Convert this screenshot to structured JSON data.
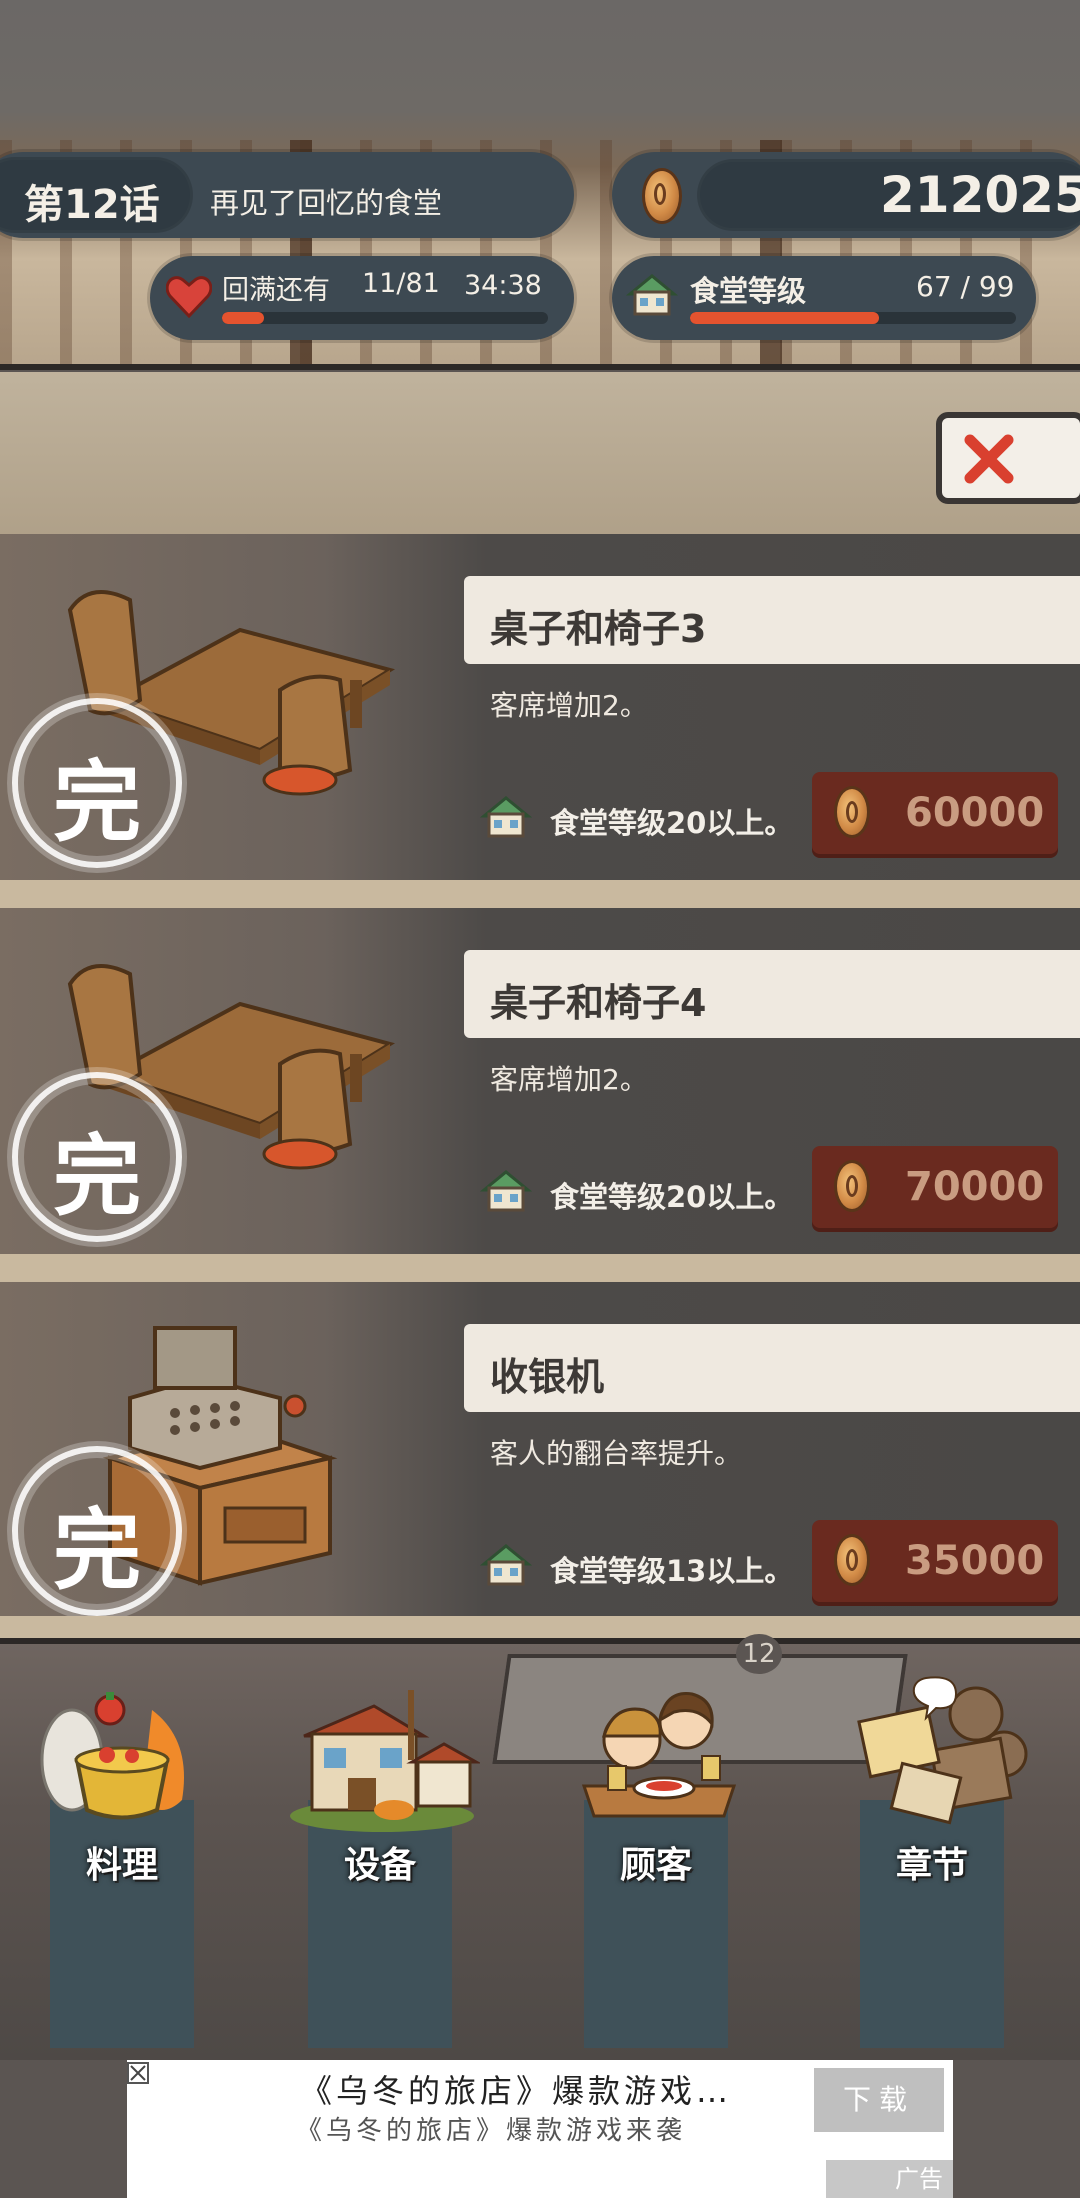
{
  "hud": {
    "chapter_label": "第12话",
    "chapter_title": "再见了回忆的食堂",
    "coins": "212025",
    "stamina_label": "回满还有",
    "stamina_count": "11/81",
    "stamina_timer": "34:38",
    "stamina_progress": 0.13,
    "level_label": "食堂等级",
    "level_value": "67 / 99",
    "level_progress": 0.58
  },
  "items": [
    {
      "name": "桌子和椅子3",
      "desc": "客席增加2。",
      "requirement": "食堂等级20以上。",
      "price": "60000",
      "stamp": "完",
      "icon": "table-chair-icon"
    },
    {
      "name": "桌子和椅子4",
      "desc": "客席增加2。",
      "requirement": "食堂等级20以上。",
      "price": "70000",
      "stamp": "完",
      "icon": "table-chair-icon"
    },
    {
      "name": "收银机",
      "desc": "客人的翻台率提升。",
      "requirement": "食堂等级13以上。",
      "price": "35000",
      "stamp": "完",
      "icon": "cash-register-icon"
    }
  ],
  "bottom_badge": "12",
  "nav": [
    {
      "label": "料理",
      "icon": "cooking-pot-icon"
    },
    {
      "label": "设备",
      "icon": "shop-building-icon"
    },
    {
      "label": "顾客",
      "icon": "customers-icon"
    },
    {
      "label": "章节",
      "icon": "film-projector-icon"
    }
  ],
  "ad": {
    "title": "《乌冬的旅店》爆款游戏…",
    "subtitle": "《乌冬的旅店》爆款游戏来袭",
    "button": "下载",
    "tag": "广告"
  },
  "colors": {
    "hud_pill": "#3d4952",
    "progress_fill": "#e5532f",
    "price_button": "#6a2a1f",
    "name_bar": "#efe9e0",
    "nav_column": "#3f5159"
  }
}
